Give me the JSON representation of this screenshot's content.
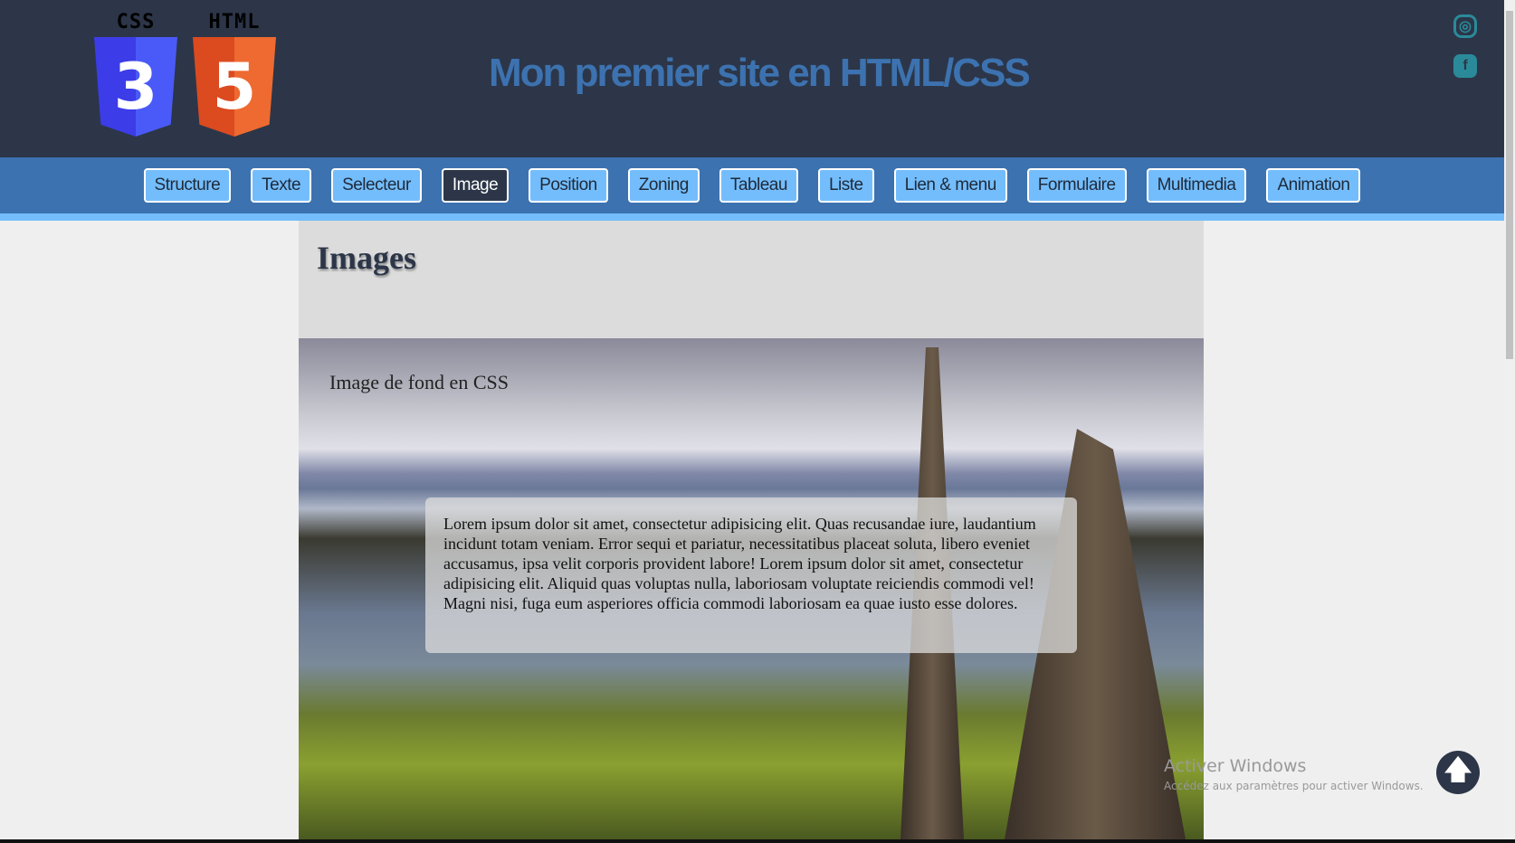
{
  "header": {
    "logo_css": "CSS",
    "logo_html": "HTML",
    "logo_css_num": "3",
    "logo_html_num": "5",
    "title": "Mon premier site en HTML/CSS",
    "instagram_icon": "instagram-icon",
    "facebook_icon": "facebook-icon",
    "instagram_glyph": "◎",
    "facebook_glyph": "f"
  },
  "nav": {
    "items": [
      "Structure",
      "Texte",
      "Selecteur",
      "Image",
      "Position",
      "Zoning",
      "Tableau",
      "Liste",
      "Lien & menu",
      "Formulaire",
      "Multimedia",
      "Animation"
    ],
    "active": "Image"
  },
  "main": {
    "heading": "Images",
    "caption": "Image de fond en CSS",
    "body": "Lorem ipsum dolor sit amet, consectetur adipisicing elit. Quas recusandae iure, laudantium incidunt totam veniam. Error sequi et pariatur, necessitatibus placeat soluta, libero eveniet accusamus, ipsa velit corporis provident labore! Lorem ipsum dolor sit amet, consectetur adipisicing elit. Aliquid quas voluptas nulla, laboriosam voluptate reiciendis commodi vel! Magni nisi, fuga eum asperiores officia commodi laboriosam ea quae iusto esse dolores."
  },
  "watermark": {
    "line1": "Activer Windows",
    "line2": "Accédez aux paramètres pour activer Windows."
  },
  "scroll_top_glyph": "🡅",
  "colors": {
    "header_bg": "#2c3648",
    "nav_bg": "#3d72b0",
    "button_bg": "#74bdfc",
    "title": "#3d72b0"
  }
}
